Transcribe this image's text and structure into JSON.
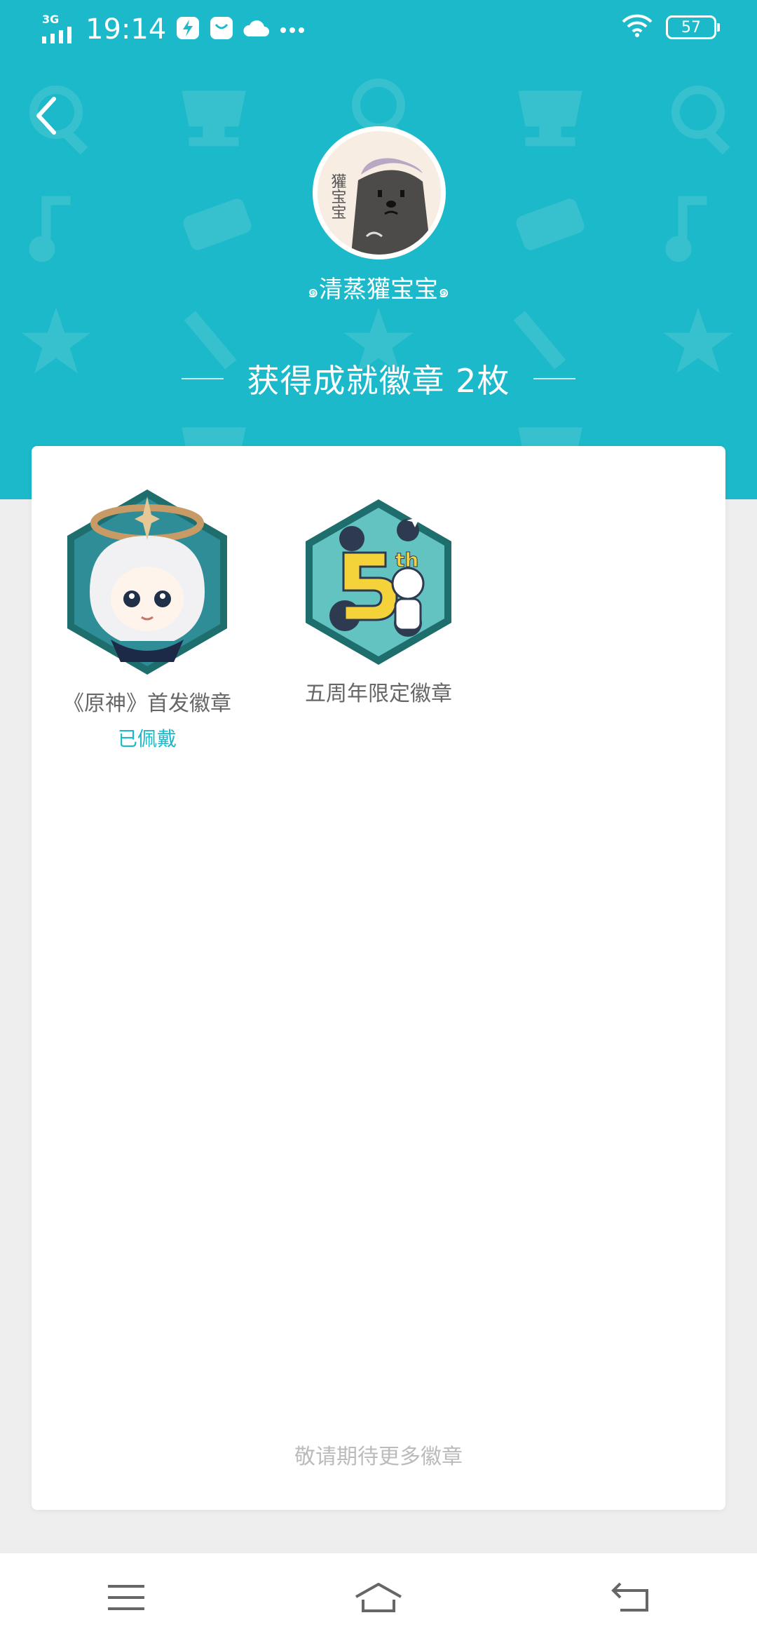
{
  "status_bar": {
    "network": "3G",
    "time": "19:14",
    "battery": "57"
  },
  "header": {
    "username": "清蒸獾宝宝",
    "avatar_text": "獾宝宝",
    "badge_count_text": "获得成就徽章 2枚"
  },
  "badges": [
    {
      "name": "《原神》首发徽章",
      "status": "已佩戴",
      "icon": "genshin-paimon-badge"
    },
    {
      "name": "五周年限定徽章",
      "status": "",
      "icon": "fifth-anniversary-badge"
    }
  ],
  "footer_tip": "敬请期待更多徽章",
  "nav": [
    "menu-icon",
    "home-icon",
    "back-icon"
  ],
  "colors": {
    "accent": "#1bb9c9",
    "badge_frame": "#1f6e6e",
    "background": "#eeeeee"
  }
}
